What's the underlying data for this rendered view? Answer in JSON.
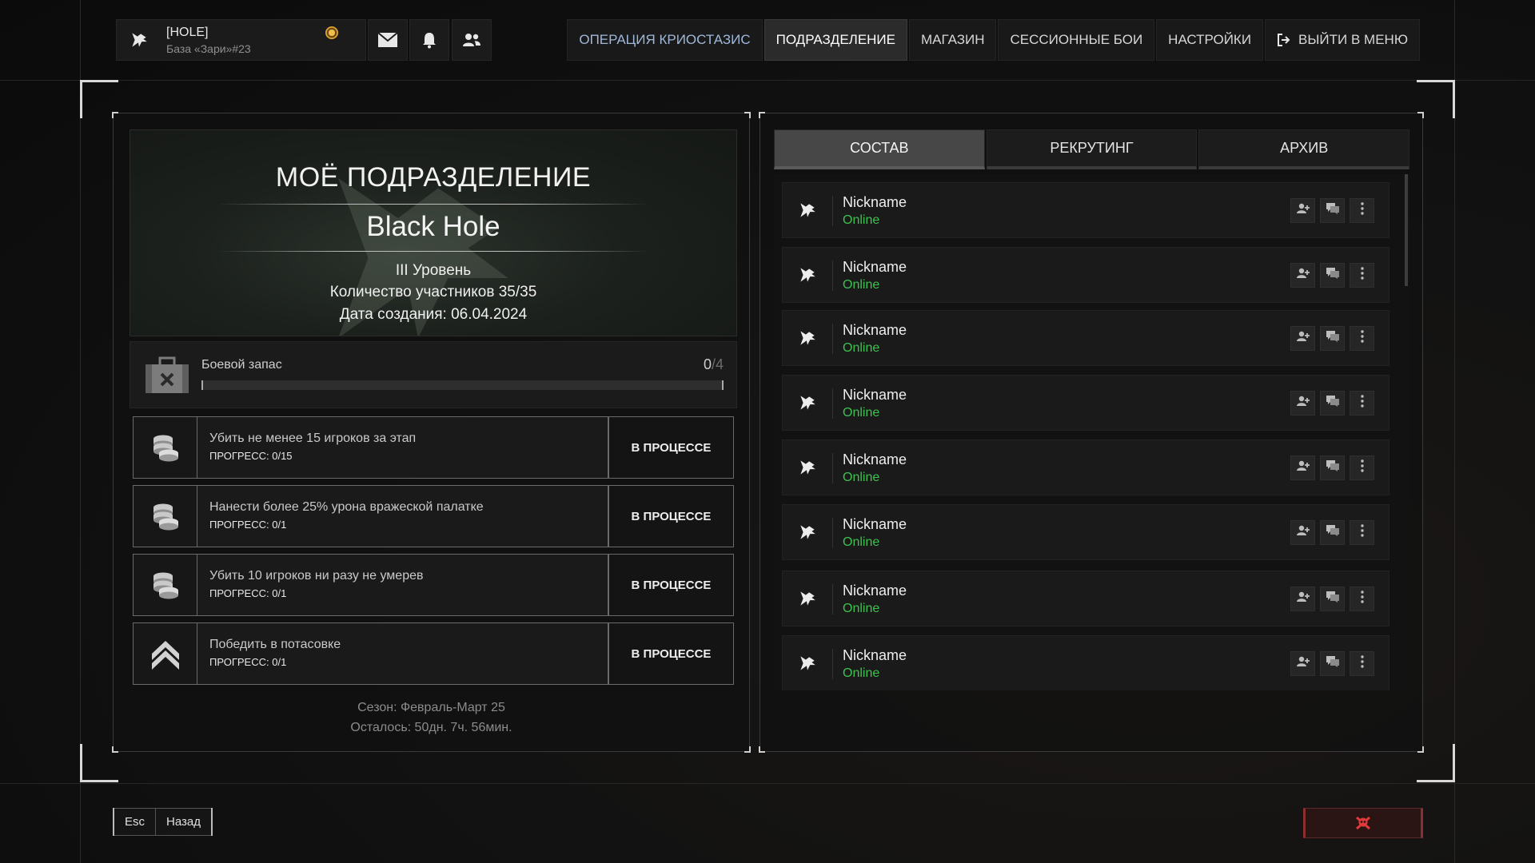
{
  "player": {
    "tag": "[HOLE]",
    "base": "База «Зари»#23"
  },
  "nav": {
    "items": [
      {
        "label": "ОПЕРАЦИЯ КРИОСТАЗИС",
        "state": "link"
      },
      {
        "label": "ПОДРАЗДЕЛЕНИЕ",
        "state": "active"
      },
      {
        "label": "МАГАЗИН",
        "state": "normal"
      },
      {
        "label": "СЕССИОННЫЕ БОИ",
        "state": "normal"
      },
      {
        "label": "НАСТРОЙКИ",
        "state": "normal"
      }
    ],
    "exit_label": "ВЫЙТИ В МЕНЮ"
  },
  "unit": {
    "title": "МОЁ ПОДРАЗДЕЛЕНИЕ",
    "name": "Black Hole",
    "level": "III Уровень",
    "members": "Количество участников 35/35",
    "created": "Дата создания: 06.04.2024"
  },
  "supply": {
    "label": "Боевой запас",
    "current": "0",
    "max": "/4",
    "progress": 0
  },
  "quests": [
    {
      "icon": "coins-icon",
      "title": "Убить не менее 15 игроков за этап",
      "progress": "ПРОГРЕСС: 0/15",
      "status": "В ПРОЦЕССЕ"
    },
    {
      "icon": "coins-icon",
      "title": "Нанести более 25% урона вражеской палатке",
      "progress": "ПРОГРЕСС: 0/1",
      "status": "В ПРОЦЕССЕ"
    },
    {
      "icon": "coins-icon",
      "title": "Убить 10 игроков ни разу не умерев",
      "progress": "ПРОГРЕСС: 0/1",
      "status": "В ПРОЦЕССЕ"
    },
    {
      "icon": "rank-chevron-icon",
      "title": "Победить в потасовке",
      "progress": "ПРОГРЕСС: 0/1",
      "status": "В ПРОЦЕССЕ"
    }
  ],
  "season": {
    "name": "Сезон: Февраль-Март 25",
    "remaining": "Осталось: 50дн. 7ч. 56мин."
  },
  "tabs": [
    {
      "label": "СОСТАВ",
      "active": true
    },
    {
      "label": "РЕКРУТИНГ",
      "active": false
    },
    {
      "label": "АРХИВ",
      "active": false
    }
  ],
  "members": [
    {
      "nickname": "Nickname",
      "status": "Online"
    },
    {
      "nickname": "Nickname",
      "status": "Online"
    },
    {
      "nickname": "Nickname",
      "status": "Online"
    },
    {
      "nickname": "Nickname",
      "status": "Online"
    },
    {
      "nickname": "Nickname",
      "status": "Online"
    },
    {
      "nickname": "Nickname",
      "status": "Online"
    },
    {
      "nickname": "Nickname",
      "status": "Online"
    },
    {
      "nickname": "Nickname",
      "status": "Online"
    }
  ],
  "footer": {
    "key": "Esc",
    "back_label": "Назад"
  },
  "colors": {
    "online": "#3fc14f",
    "nav_link": "#9fb8d9",
    "danger": "#e03a3a",
    "accent_gold": "#f2c04a"
  }
}
